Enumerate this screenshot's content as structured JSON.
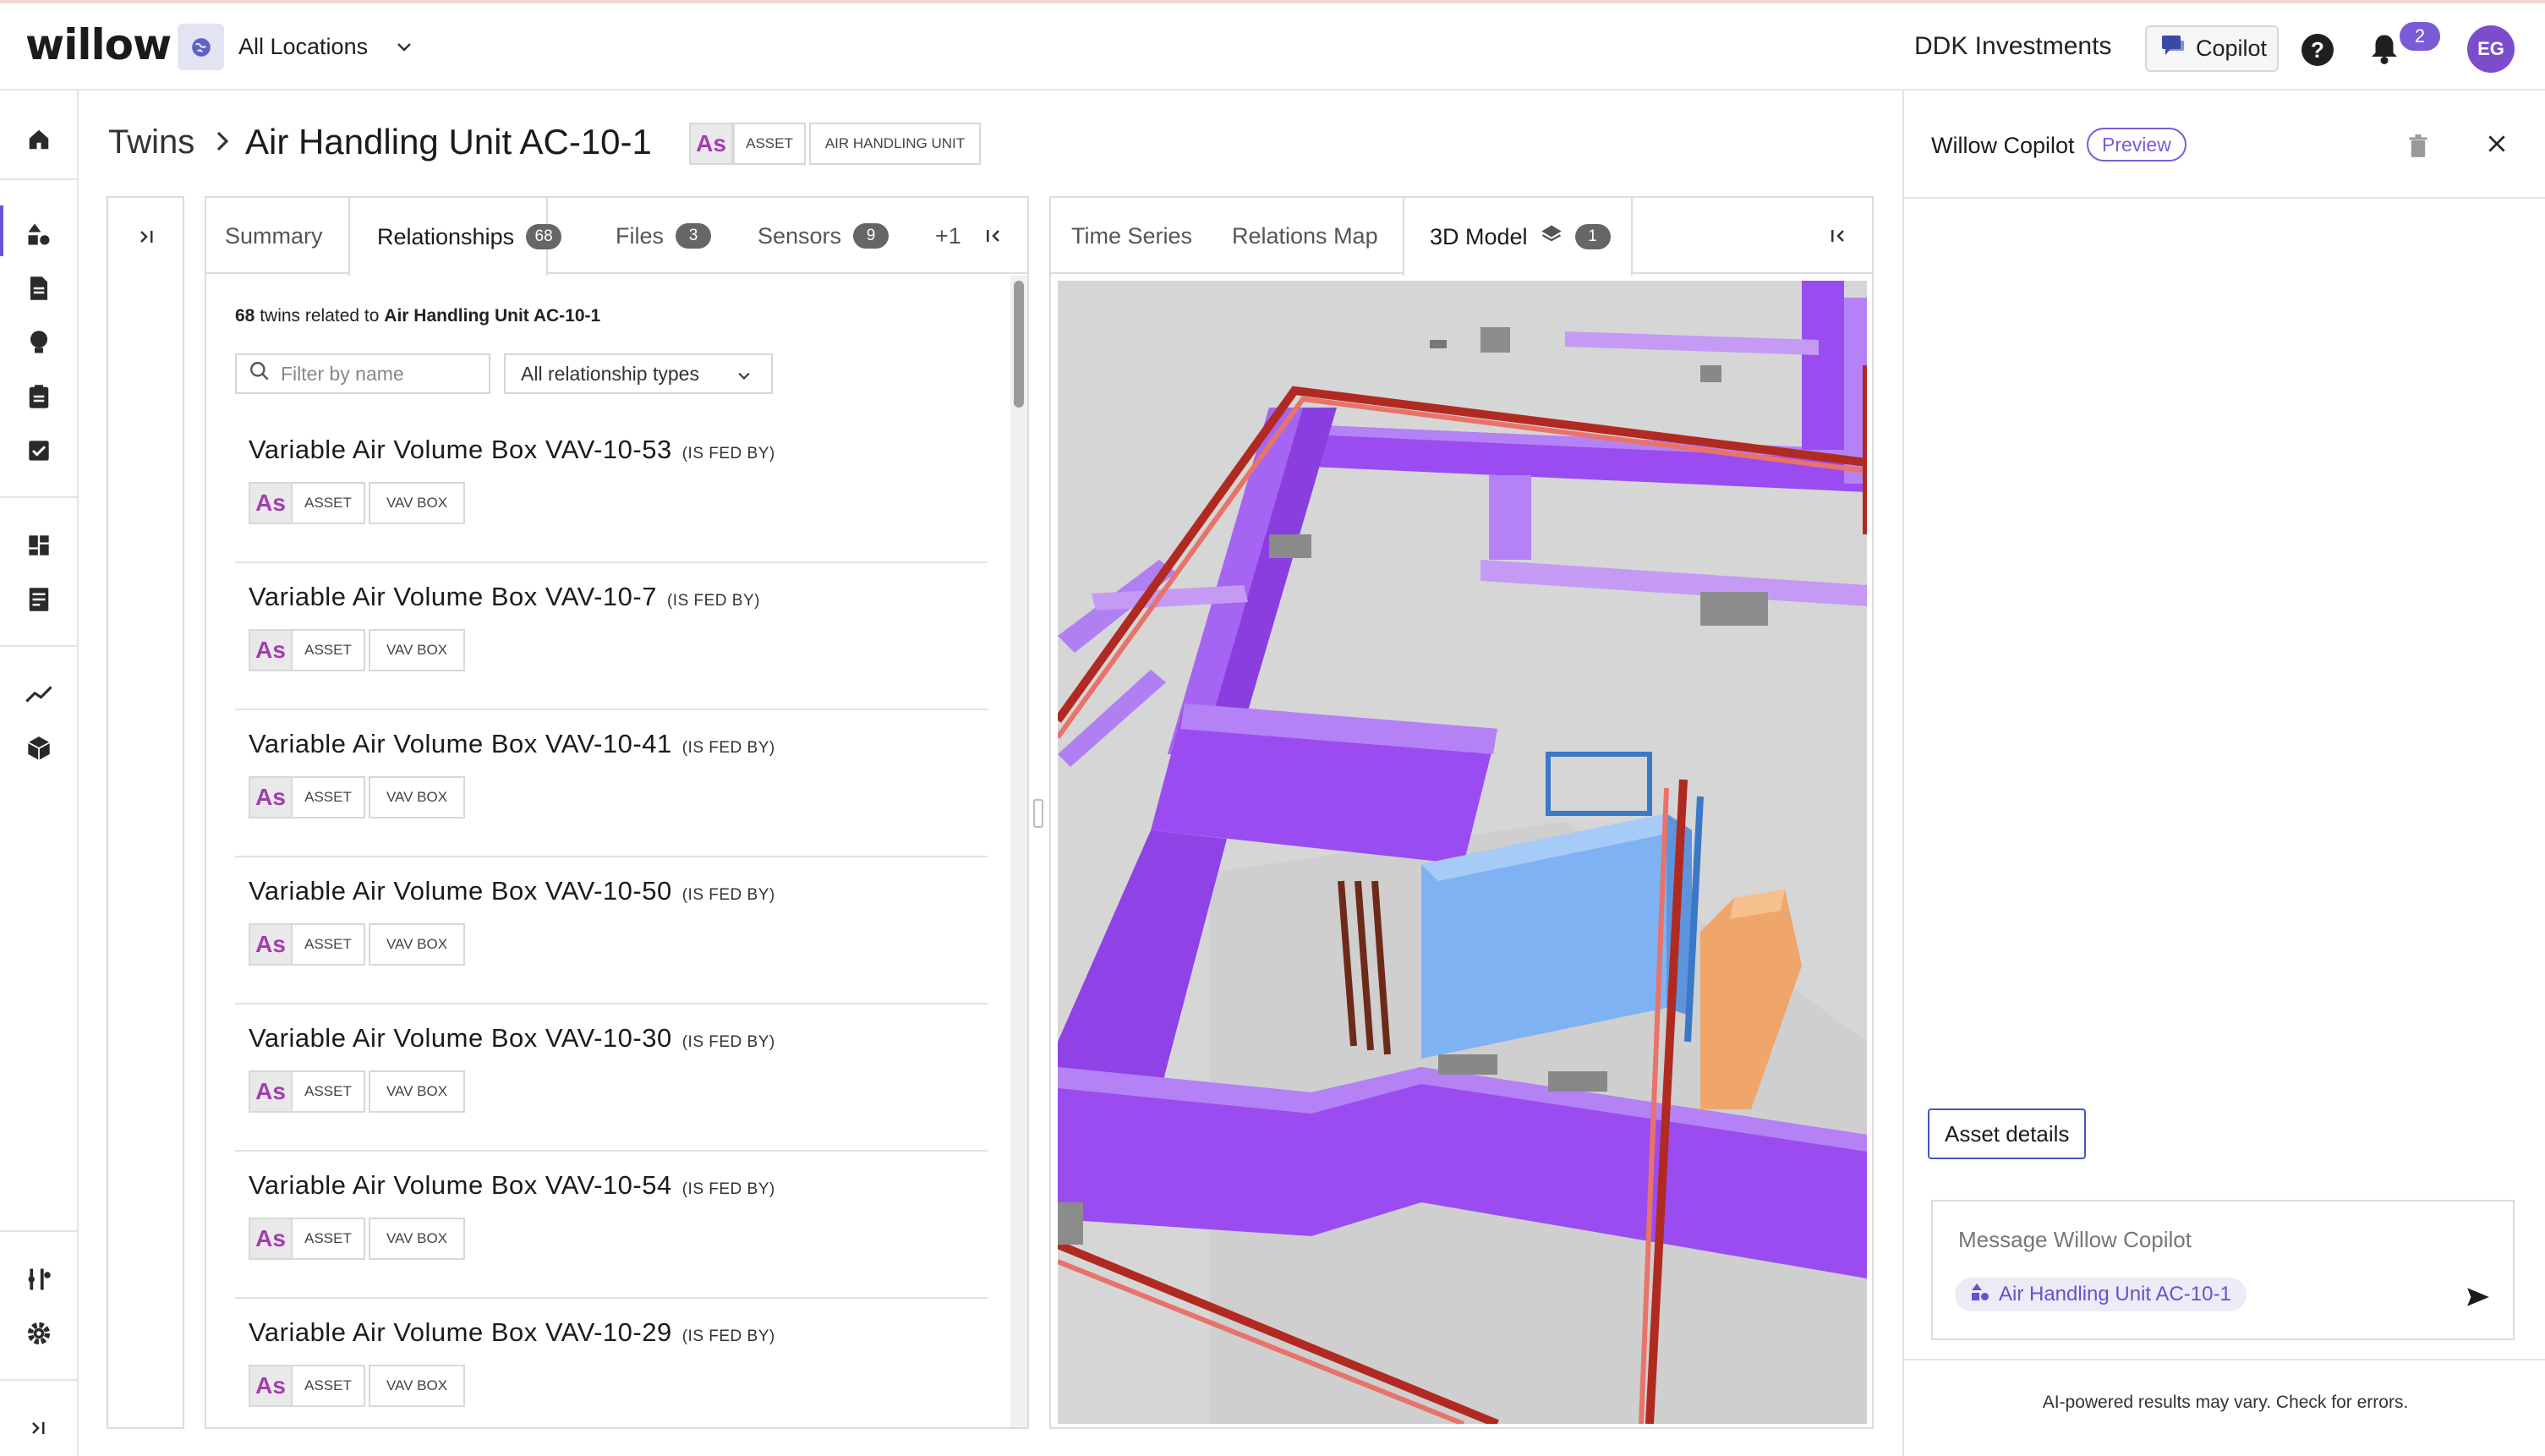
{
  "app": {
    "logo": "willow"
  },
  "header": {
    "location": "All Locations",
    "organization": "DDK Investments",
    "copilot_label": "Copilot",
    "help_label": "?",
    "notifications_count": "2",
    "user_initials": "EG"
  },
  "breadcrumb": {
    "root": "Twins",
    "current": "Air Handling Unit AC-10-1",
    "chips": {
      "as": "As",
      "asset": "ASSET",
      "category": "AIR HANDLING UNIT"
    }
  },
  "left_tabs": [
    {
      "label": "Summary",
      "count": ""
    },
    {
      "label": "Relationships",
      "count": "68"
    },
    {
      "label": "Files",
      "count": "3"
    },
    {
      "label": "Sensors",
      "count": "9"
    },
    {
      "label": "+1",
      "count": ""
    }
  ],
  "relationships": {
    "summary_count": "68",
    "summary_text": "twins related to",
    "summary_target": "Air Handling Unit AC-10-1",
    "filter_placeholder": "Filter by name",
    "type_filter": "All relationship types",
    "items": [
      {
        "name": "Variable Air Volume Box VAV-10-53",
        "relation": "(IS FED BY)",
        "as": "As",
        "kind": "ASSET",
        "category": "VAV BOX"
      },
      {
        "name": "Variable Air Volume Box VAV-10-7",
        "relation": "(IS FED BY)",
        "as": "As",
        "kind": "ASSET",
        "category": "VAV BOX"
      },
      {
        "name": "Variable Air Volume Box VAV-10-41",
        "relation": "(IS FED BY)",
        "as": "As",
        "kind": "ASSET",
        "category": "VAV BOX"
      },
      {
        "name": "Variable Air Volume Box VAV-10-50",
        "relation": "(IS FED BY)",
        "as": "As",
        "kind": "ASSET",
        "category": "VAV BOX"
      },
      {
        "name": "Variable Air Volume Box VAV-10-30",
        "relation": "(IS FED BY)",
        "as": "As",
        "kind": "ASSET",
        "category": "VAV BOX"
      },
      {
        "name": "Variable Air Volume Box VAV-10-54",
        "relation": "(IS FED BY)",
        "as": "As",
        "kind": "ASSET",
        "category": "VAV BOX"
      },
      {
        "name": "Variable Air Volume Box VAV-10-29",
        "relation": "(IS FED BY)",
        "as": "As",
        "kind": "ASSET",
        "category": "VAV BOX"
      }
    ]
  },
  "right_tabs": [
    {
      "label": "Time Series",
      "count": ""
    },
    {
      "label": "Relations Map",
      "count": ""
    },
    {
      "label": "3D Model",
      "count": "1"
    }
  ],
  "copilot": {
    "title": "Willow Copilot",
    "badge": "Preview",
    "suggestion": "Asset details",
    "placeholder": "Message Willow Copilot",
    "context_chip": "Air Handling Unit AC-10-1",
    "disclaimer": "AI-powered results may vary. Check for errors."
  },
  "colors": {
    "accent": "#7b5ad6",
    "asset_chip_text": "#a43cb0",
    "duct": "#9b4cf0",
    "pipe": "#c8352a",
    "ahu": "#7fb2f2",
    "equipment": "#f0a56a"
  }
}
